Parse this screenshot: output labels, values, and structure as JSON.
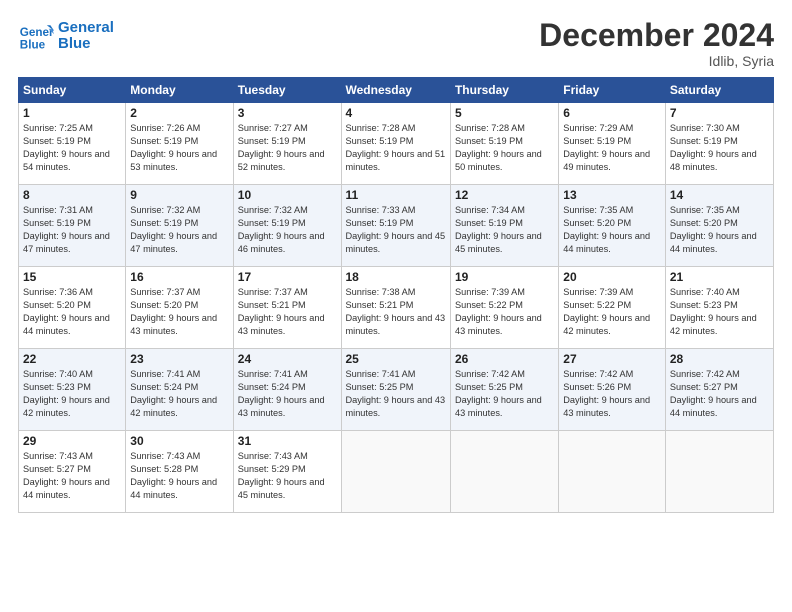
{
  "header": {
    "logo_line1": "General",
    "logo_line2": "Blue",
    "title": "December 2024",
    "subtitle": "Idlib, Syria"
  },
  "weekdays": [
    "Sunday",
    "Monday",
    "Tuesday",
    "Wednesday",
    "Thursday",
    "Friday",
    "Saturday"
  ],
  "weeks": [
    [
      {
        "day": "1",
        "sunrise": "Sunrise: 7:25 AM",
        "sunset": "Sunset: 5:19 PM",
        "daylight": "Daylight: 9 hours and 54 minutes."
      },
      {
        "day": "2",
        "sunrise": "Sunrise: 7:26 AM",
        "sunset": "Sunset: 5:19 PM",
        "daylight": "Daylight: 9 hours and 53 minutes."
      },
      {
        "day": "3",
        "sunrise": "Sunrise: 7:27 AM",
        "sunset": "Sunset: 5:19 PM",
        "daylight": "Daylight: 9 hours and 52 minutes."
      },
      {
        "day": "4",
        "sunrise": "Sunrise: 7:28 AM",
        "sunset": "Sunset: 5:19 PM",
        "daylight": "Daylight: 9 hours and 51 minutes."
      },
      {
        "day": "5",
        "sunrise": "Sunrise: 7:28 AM",
        "sunset": "Sunset: 5:19 PM",
        "daylight": "Daylight: 9 hours and 50 minutes."
      },
      {
        "day": "6",
        "sunrise": "Sunrise: 7:29 AM",
        "sunset": "Sunset: 5:19 PM",
        "daylight": "Daylight: 9 hours and 49 minutes."
      },
      {
        "day": "7",
        "sunrise": "Sunrise: 7:30 AM",
        "sunset": "Sunset: 5:19 PM",
        "daylight": "Daylight: 9 hours and 48 minutes."
      }
    ],
    [
      {
        "day": "8",
        "sunrise": "Sunrise: 7:31 AM",
        "sunset": "Sunset: 5:19 PM",
        "daylight": "Daylight: 9 hours and 47 minutes."
      },
      {
        "day": "9",
        "sunrise": "Sunrise: 7:32 AM",
        "sunset": "Sunset: 5:19 PM",
        "daylight": "Daylight: 9 hours and 47 minutes."
      },
      {
        "day": "10",
        "sunrise": "Sunrise: 7:32 AM",
        "sunset": "Sunset: 5:19 PM",
        "daylight": "Daylight: 9 hours and 46 minutes."
      },
      {
        "day": "11",
        "sunrise": "Sunrise: 7:33 AM",
        "sunset": "Sunset: 5:19 PM",
        "daylight": "Daylight: 9 hours and 45 minutes."
      },
      {
        "day": "12",
        "sunrise": "Sunrise: 7:34 AM",
        "sunset": "Sunset: 5:19 PM",
        "daylight": "Daylight: 9 hours and 45 minutes."
      },
      {
        "day": "13",
        "sunrise": "Sunrise: 7:35 AM",
        "sunset": "Sunset: 5:20 PM",
        "daylight": "Daylight: 9 hours and 44 minutes."
      },
      {
        "day": "14",
        "sunrise": "Sunrise: 7:35 AM",
        "sunset": "Sunset: 5:20 PM",
        "daylight": "Daylight: 9 hours and 44 minutes."
      }
    ],
    [
      {
        "day": "15",
        "sunrise": "Sunrise: 7:36 AM",
        "sunset": "Sunset: 5:20 PM",
        "daylight": "Daylight: 9 hours and 44 minutes."
      },
      {
        "day": "16",
        "sunrise": "Sunrise: 7:37 AM",
        "sunset": "Sunset: 5:20 PM",
        "daylight": "Daylight: 9 hours and 43 minutes."
      },
      {
        "day": "17",
        "sunrise": "Sunrise: 7:37 AM",
        "sunset": "Sunset: 5:21 PM",
        "daylight": "Daylight: 9 hours and 43 minutes."
      },
      {
        "day": "18",
        "sunrise": "Sunrise: 7:38 AM",
        "sunset": "Sunset: 5:21 PM",
        "daylight": "Daylight: 9 hours and 43 minutes."
      },
      {
        "day": "19",
        "sunrise": "Sunrise: 7:39 AM",
        "sunset": "Sunset: 5:22 PM",
        "daylight": "Daylight: 9 hours and 43 minutes."
      },
      {
        "day": "20",
        "sunrise": "Sunrise: 7:39 AM",
        "sunset": "Sunset: 5:22 PM",
        "daylight": "Daylight: 9 hours and 42 minutes."
      },
      {
        "day": "21",
        "sunrise": "Sunrise: 7:40 AM",
        "sunset": "Sunset: 5:23 PM",
        "daylight": "Daylight: 9 hours and 42 minutes."
      }
    ],
    [
      {
        "day": "22",
        "sunrise": "Sunrise: 7:40 AM",
        "sunset": "Sunset: 5:23 PM",
        "daylight": "Daylight: 9 hours and 42 minutes."
      },
      {
        "day": "23",
        "sunrise": "Sunrise: 7:41 AM",
        "sunset": "Sunset: 5:24 PM",
        "daylight": "Daylight: 9 hours and 42 minutes."
      },
      {
        "day": "24",
        "sunrise": "Sunrise: 7:41 AM",
        "sunset": "Sunset: 5:24 PM",
        "daylight": "Daylight: 9 hours and 43 minutes."
      },
      {
        "day": "25",
        "sunrise": "Sunrise: 7:41 AM",
        "sunset": "Sunset: 5:25 PM",
        "daylight": "Daylight: 9 hours and 43 minutes."
      },
      {
        "day": "26",
        "sunrise": "Sunrise: 7:42 AM",
        "sunset": "Sunset: 5:25 PM",
        "daylight": "Daylight: 9 hours and 43 minutes."
      },
      {
        "day": "27",
        "sunrise": "Sunrise: 7:42 AM",
        "sunset": "Sunset: 5:26 PM",
        "daylight": "Daylight: 9 hours and 43 minutes."
      },
      {
        "day": "28",
        "sunrise": "Sunrise: 7:42 AM",
        "sunset": "Sunset: 5:27 PM",
        "daylight": "Daylight: 9 hours and 44 minutes."
      }
    ],
    [
      {
        "day": "29",
        "sunrise": "Sunrise: 7:43 AM",
        "sunset": "Sunset: 5:27 PM",
        "daylight": "Daylight: 9 hours and 44 minutes."
      },
      {
        "day": "30",
        "sunrise": "Sunrise: 7:43 AM",
        "sunset": "Sunset: 5:28 PM",
        "daylight": "Daylight: 9 hours and 44 minutes."
      },
      {
        "day": "31",
        "sunrise": "Sunrise: 7:43 AM",
        "sunset": "Sunset: 5:29 PM",
        "daylight": "Daylight: 9 hours and 45 minutes."
      },
      null,
      null,
      null,
      null
    ]
  ]
}
